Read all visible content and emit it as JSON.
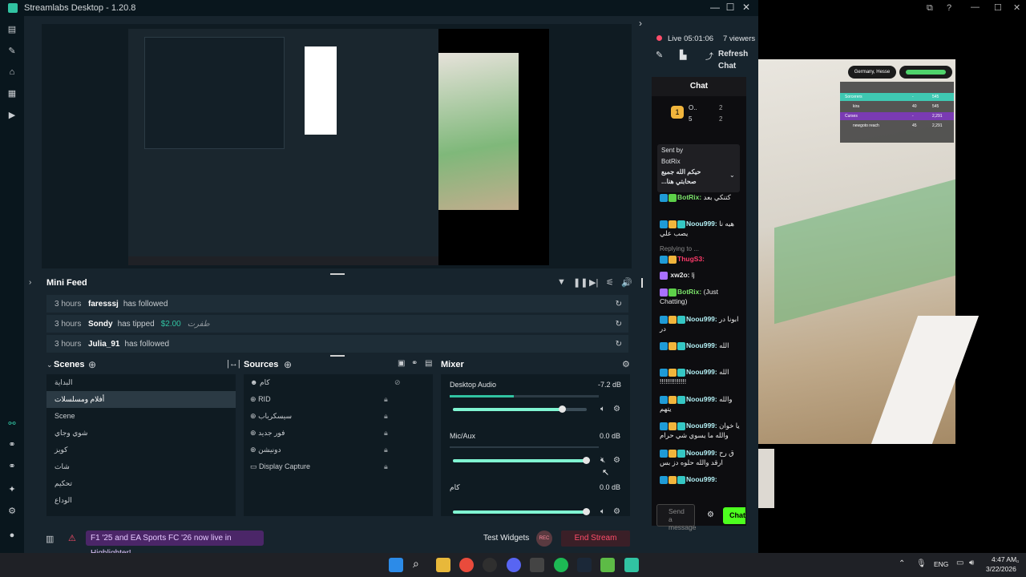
{
  "window": {
    "title": "Streamlabs Desktop - 1.20.8"
  },
  "stream": {
    "live": "Live 05:01:06",
    "viewers": "7 viewers",
    "refresh": "Refresh",
    "refresh2": "Chat"
  },
  "chat": {
    "title": "Chat",
    "send_placeholder": "Send a message",
    "send": "Chat",
    "pinned": {
      "label": "Sent by",
      "name": "BotRix",
      "text": "حيكم الله جميع",
      "text2": "...صحابتي هنا"
    },
    "top": {
      "a": "O..",
      "b": "5",
      "c": "2",
      "d": "2",
      "rank": "1"
    },
    "messages": [
      {
        "name": "Noou999:",
        "text": ""
      },
      {
        "name": "BotRix:",
        "text": "كتنكي بعد"
      },
      {
        "name": "Noou999:",
        "text": "هيه نا يصب علي"
      },
      {
        "reply": "Replying to ...",
        "name": "ThugS3:",
        "text": ""
      },
      {
        "name": "xw2o:",
        "text": "lj"
      },
      {
        "name": "BotRix:",
        "text": "(Just Chatting)"
      },
      {
        "name": "Noou999:",
        "text": "ابونا در در"
      },
      {
        "name": "Noou999:",
        "text": "الله"
      },
      {
        "name": "Noou999:",
        "text": "الله !!!!!!!!!!!!!!"
      },
      {
        "name": "Noou999:",
        "text": "والله يتهم"
      },
      {
        "name": "Noou999:",
        "text": "يا خوان والله ما يسوي شي حرام"
      },
      {
        "name": "Noou999:",
        "text": "ق رح ارقد والله حلوه دز بس"
      },
      {
        "name": "Noou999:",
        "text": ""
      }
    ]
  },
  "minifeed": {
    "title": "Mini Feed",
    "rows": [
      {
        "time": "3 hours",
        "name": "faresssj",
        "action": "has followed",
        "amount": "",
        "note": ""
      },
      {
        "time": "3 hours",
        "name": "Sondy",
        "action": "has tipped",
        "amount": "$2.00",
        "note": "طفرت"
      },
      {
        "time": "3 hours",
        "name": "Julia_91",
        "action": "has followed",
        "amount": "",
        "note": ""
      }
    ]
  },
  "scenes": {
    "title": "Scenes",
    "items": [
      "البداية",
      "أفلام ومسلسلات",
      "Scene",
      "شوي وجاي",
      "كويز",
      "شات",
      "تحكيم",
      "الوداع"
    ]
  },
  "sources": {
    "title": "Sources",
    "items": [
      "كام",
      "RID",
      "سيسكرباب",
      "فور جديد",
      "دونيشن",
      "Display Capture"
    ]
  },
  "mixer": {
    "title": "Mixer",
    "tracks": [
      {
        "name": "Desktop Audio",
        "db": "-7.2 dB",
        "vol": 0.82
      },
      {
        "name": "Mic/Aux",
        "db": "0.0 dB",
        "vol": 1.0
      },
      {
        "name": "كام",
        "db": "0.0 dB",
        "vol": 1.0
      }
    ]
  },
  "footer": {
    "banner": "F1 '25 and EA Sports FC '26 now live in Highlighter!",
    "test_widgets": "Test Widgets",
    "rec": "REC",
    "end_stream": "End Stream"
  },
  "game": {
    "location": "Germany, Hesse",
    "table": [
      {
        "name": "Sorcerers",
        "a": "-",
        "b": "545"
      },
      {
        "name": "kira",
        "a": "40",
        "b": "545"
      },
      {
        "name": "Curses",
        "a": "-",
        "b": "2,291"
      },
      {
        "name": "newgoto reach",
        "a": "45",
        "b": "2,291"
      }
    ]
  },
  "taskbar": {
    "lang": "ENG",
    "time": "4:47 AM",
    "date": "3/22/2026"
  },
  "colors": {
    "accent": "#31c3a2",
    "end": "#ff4d6a",
    "banner": "#5b2a7a"
  }
}
